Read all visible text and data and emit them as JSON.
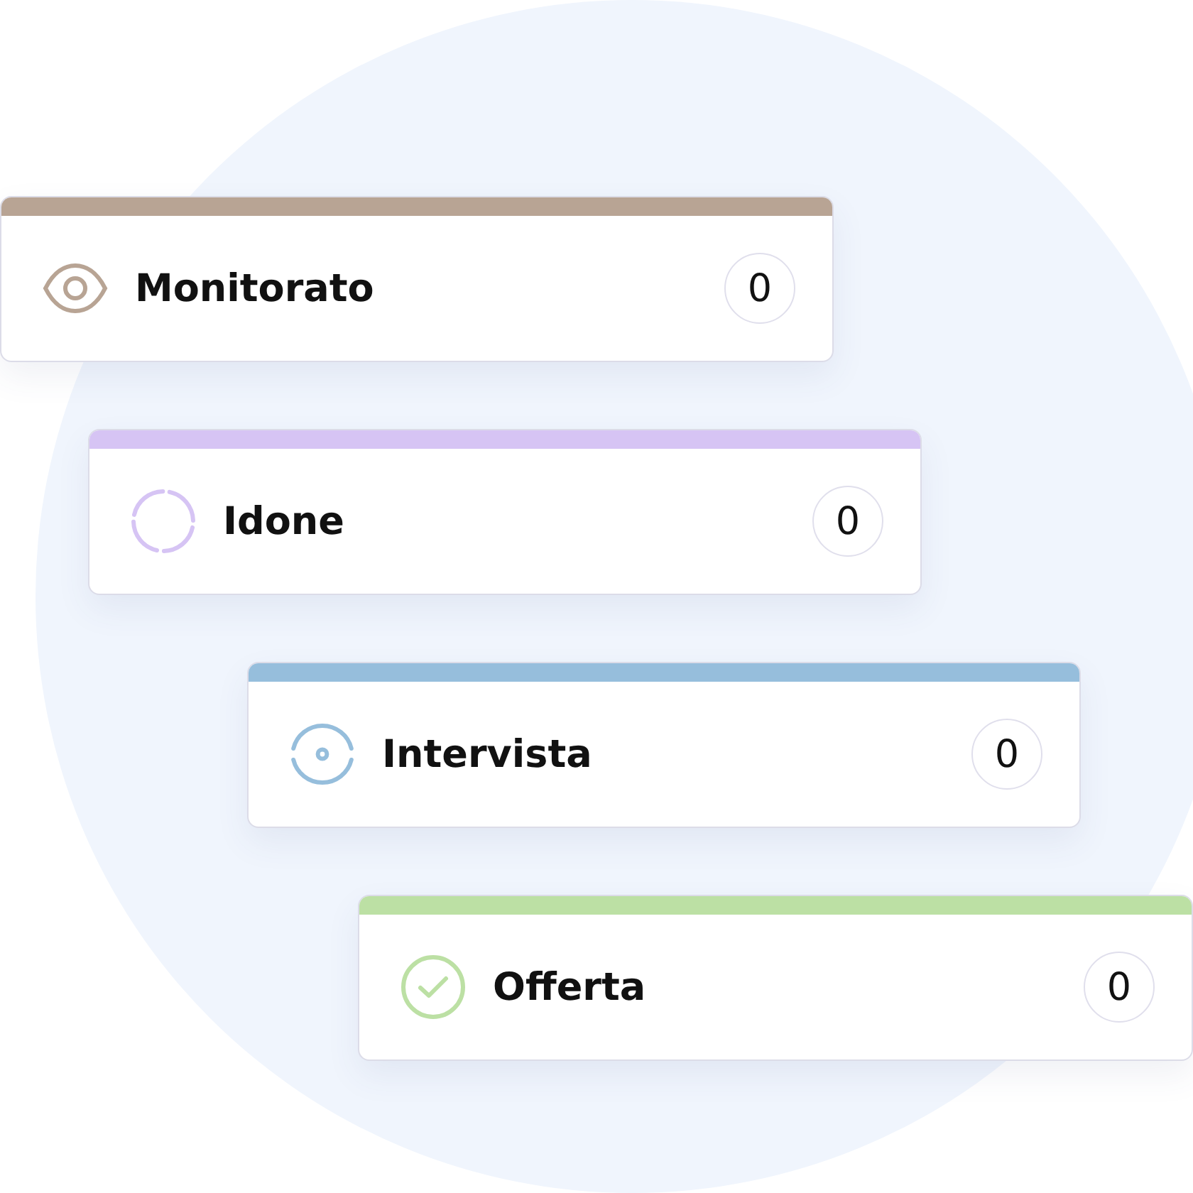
{
  "stages": [
    {
      "kind": "eye",
      "label": "Monitorato",
      "count": "0",
      "color": "#b8a494"
    },
    {
      "kind": "dashed-ring",
      "label": "Idone",
      "count": "0",
      "color": "#d6c4f4"
    },
    {
      "kind": "target",
      "label": "Intervista",
      "count": "0",
      "color": "#96bedc"
    },
    {
      "kind": "check",
      "label": "Offerta",
      "count": "0",
      "color": "#bce0a4"
    }
  ]
}
